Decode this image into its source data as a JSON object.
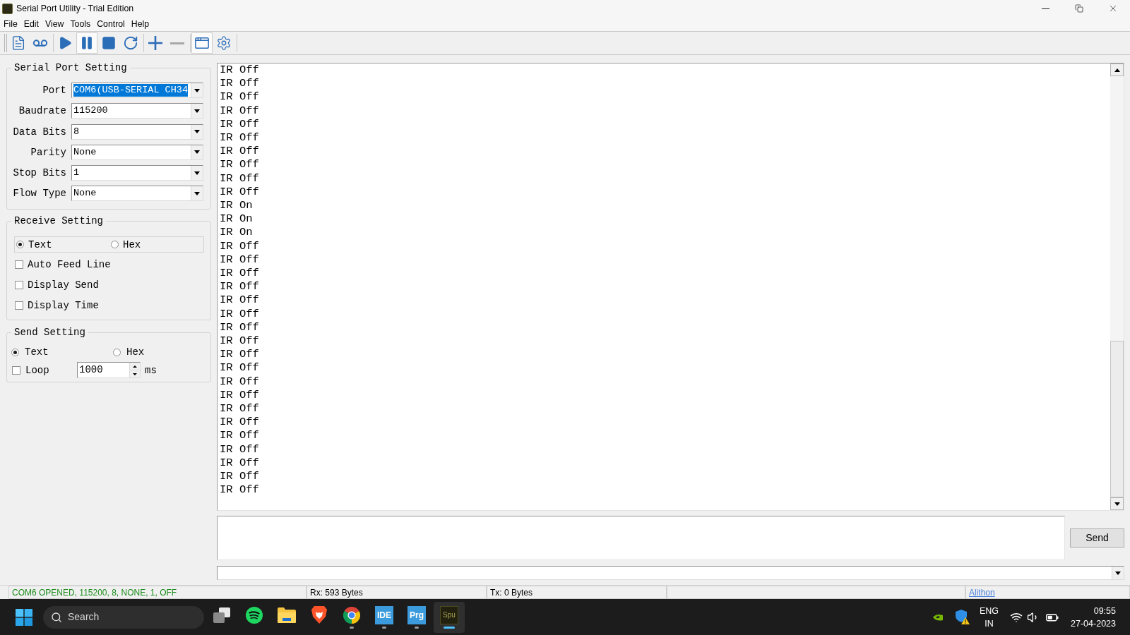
{
  "window": {
    "title": "Serial Port Utility - Trial Edition"
  },
  "menu": [
    "File",
    "Edit",
    "View",
    "Tools",
    "Control",
    "Help"
  ],
  "toolbar": [
    {
      "pressed": false,
      "disabled": false
    },
    {
      "pressed": false,
      "disabled": false
    },
    {
      "pressed": false,
      "disabled": false
    },
    {
      "pressed": true,
      "disabled": false
    },
    {
      "pressed": false,
      "disabled": false
    },
    {
      "pressed": false,
      "disabled": false
    },
    {
      "pressed": false,
      "disabled": false
    },
    {
      "pressed": false,
      "disabled": true
    },
    {
      "pressed": true,
      "disabled": false
    },
    {
      "pressed": false,
      "disabled": false
    }
  ],
  "serial_port_setting": {
    "title": "Serial Port Setting",
    "fields": [
      {
        "label": "Port",
        "value": "COM6(USB-SERIAL CH34",
        "highlighted": true
      },
      {
        "label": "Baudrate",
        "value": "115200",
        "highlighted": false
      },
      {
        "label": "Data Bits",
        "value": "8",
        "highlighted": false
      },
      {
        "label": "Parity",
        "value": "None",
        "highlighted": false
      },
      {
        "label": "Stop Bits",
        "value": "1",
        "highlighted": false
      },
      {
        "label": "Flow Type",
        "value": "None",
        "highlighted": false
      }
    ]
  },
  "receive_setting": {
    "title": "Receive Setting",
    "modes": [
      {
        "label": "Text",
        "selected": true
      },
      {
        "label": "Hex",
        "selected": false
      }
    ],
    "options": [
      {
        "label": "Auto Feed Line",
        "checked": false
      },
      {
        "label": "Display Send",
        "checked": false
      },
      {
        "label": "Display Time",
        "checked": false
      }
    ]
  },
  "send_setting": {
    "title": "Send Setting",
    "modes": [
      {
        "label": "Text",
        "selected": true
      },
      {
        "label": "Hex",
        "selected": false
      }
    ],
    "loop": {
      "label": "Loop",
      "checked": false
    },
    "interval": {
      "value": "1000",
      "unit": "ms"
    }
  },
  "receive_log": [
    "IR Off",
    "IR Off",
    "IR Off",
    "IR Off",
    "IR Off",
    "IR Off",
    "IR Off",
    "IR Off",
    "IR Off",
    "IR Off",
    "IR On",
    "IR On",
    "IR On",
    "IR Off",
    "IR Off",
    "IR Off",
    "IR Off",
    "IR Off",
    "IR Off",
    "IR Off",
    "IR Off",
    "IR Off",
    "IR Off",
    "IR Off",
    "IR Off",
    "IR Off",
    "IR Off",
    "IR Off",
    "IR Off",
    "IR Off",
    "IR Off",
    "IR Off"
  ],
  "send_button": "Send",
  "status_bar": [
    {
      "kind": "status",
      "text": "COM6 OPENED, 115200, 8, NONE, 1, OFF"
    },
    {
      "kind": "plain",
      "text": "Rx: 593 Bytes"
    },
    {
      "kind": "plain",
      "text": "Tx: 0 Bytes"
    },
    {
      "kind": "link",
      "text": "Alithon"
    }
  ],
  "taskbar": {
    "search": {
      "placeholder": "Search"
    },
    "apps": [
      {
        "kind": "stack",
        "running": false,
        "active": false
      },
      {
        "kind": "arcs",
        "running": false,
        "active": false
      },
      {
        "kind": "folder",
        "running": false,
        "active": false
      },
      {
        "kind": "lion",
        "running": false,
        "active": false
      },
      {
        "kind": "ring",
        "running": true,
        "active": false
      },
      {
        "kind": "tile",
        "label": "IDE",
        "running": true,
        "active": false
      },
      {
        "kind": "tile",
        "label": "Prg",
        "running": true,
        "active": false
      },
      {
        "kind": "darktile",
        "label": "Spu",
        "running": true,
        "active": true
      }
    ],
    "tray": {
      "language": "ENG",
      "region": "IN",
      "time": "09:55",
      "date": "27-04-2023"
    }
  }
}
